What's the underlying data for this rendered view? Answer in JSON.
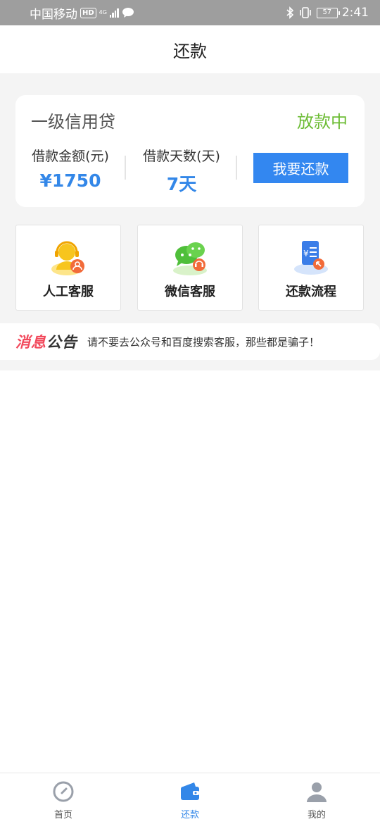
{
  "status_bar": {
    "carrier": "中国移动",
    "hd": "HD",
    "network": "4G",
    "battery": "57",
    "time": "2:41"
  },
  "header": {
    "title": "还款"
  },
  "loan_card": {
    "name": "一级信用贷",
    "status": "放款中",
    "amount_label": "借款金额(元)",
    "amount_value": "¥1750",
    "days_label": "借款天数(天)",
    "days_value": "7天",
    "repay_button": "我要还款"
  },
  "services": [
    {
      "label": "人工客服",
      "icon": "headset-agent-icon"
    },
    {
      "label": "微信客服",
      "icon": "wechat-icon"
    },
    {
      "label": "还款流程",
      "icon": "repayment-document-icon"
    }
  ],
  "notice": {
    "tag_part1": "消息",
    "tag_part2": "公告",
    "text": "请不要去公众号和百度搜索客服，那些都是骗子！"
  },
  "bottom_nav": [
    {
      "label": "首页",
      "icon": "compass-icon",
      "active": false
    },
    {
      "label": "还款",
      "icon": "wallet-icon",
      "active": true
    },
    {
      "label": "我的",
      "icon": "user-icon",
      "active": false
    }
  ],
  "colors": {
    "accent": "#3387e8",
    "status_green": "#6cbc34",
    "notice_red": "#f2495c"
  }
}
